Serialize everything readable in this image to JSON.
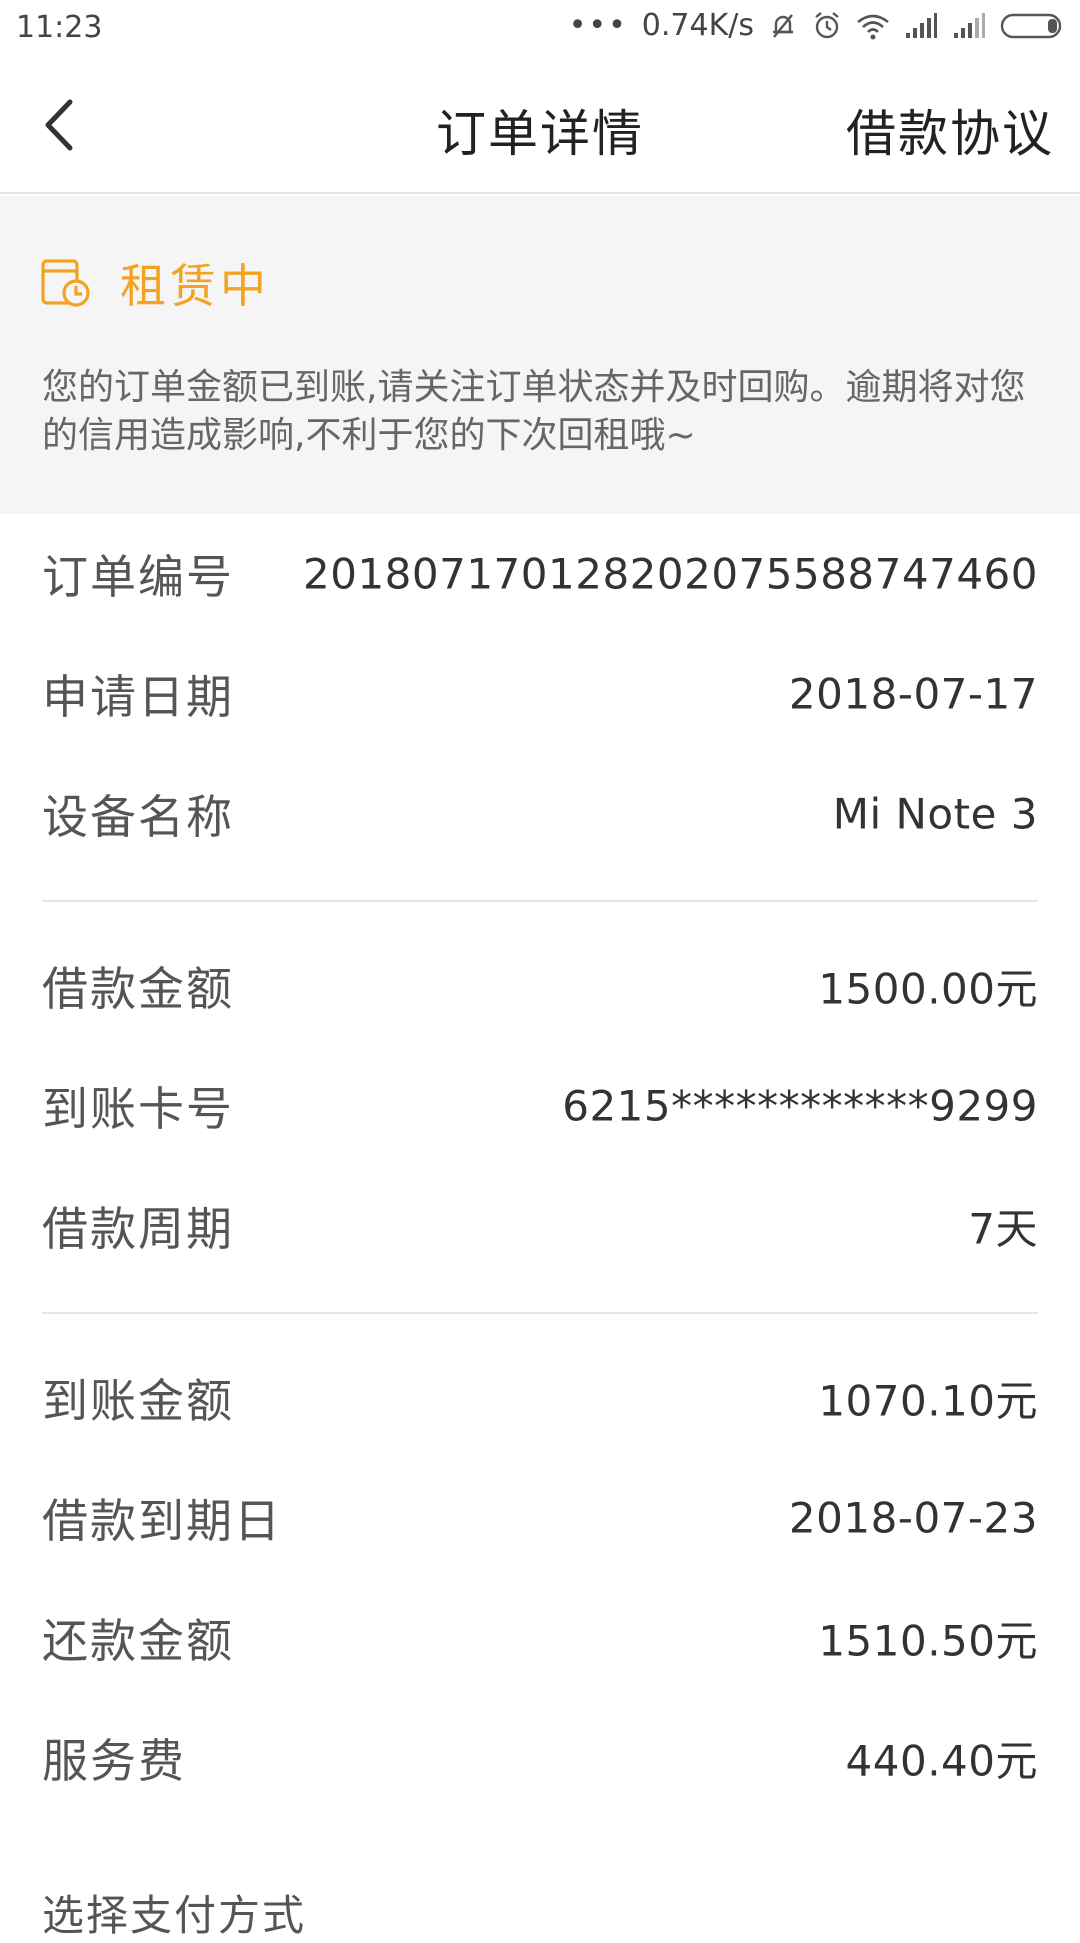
{
  "status_bar": {
    "time": "11:23",
    "dots": "•••",
    "network_speed": "0.74K/s",
    "icons": [
      "bell-muted-icon",
      "alarm-icon",
      "wifi-icon",
      "signal-icon",
      "signal-icon-2",
      "battery-icon"
    ]
  },
  "nav": {
    "title": "订单详情",
    "right_action": "借款协议",
    "back_icon": "chevron-left-icon"
  },
  "status_card": {
    "icon": "calendar-clock-icon",
    "label": "租赁中",
    "description": "您的订单金额已到账,请关注订单状态并及时回购。逾期将对您的信用造成影响,不利于您的下次回租哦~",
    "accent_color": "#f2a321"
  },
  "groups": [
    [
      {
        "label": "订单编号",
        "value": "201807170128202075588747460"
      },
      {
        "label": "申请日期",
        "value": "2018-07-17"
      },
      {
        "label": "设备名称",
        "value": "Mi Note 3"
      }
    ],
    [
      {
        "label": "借款金额",
        "value": "1500.00元"
      },
      {
        "label": "到账卡号",
        "value": "6215************9299"
      },
      {
        "label": "借款周期",
        "value": "7天"
      }
    ],
    [
      {
        "label": "到账金额",
        "value": "1070.10元"
      },
      {
        "label": "借款到期日",
        "value": "2018-07-23"
      },
      {
        "label": "还款金额",
        "value": "1510.50元"
      },
      {
        "label": "服务费",
        "value": "440.40元"
      }
    ]
  ],
  "pay_method_label": "选择支付方式"
}
